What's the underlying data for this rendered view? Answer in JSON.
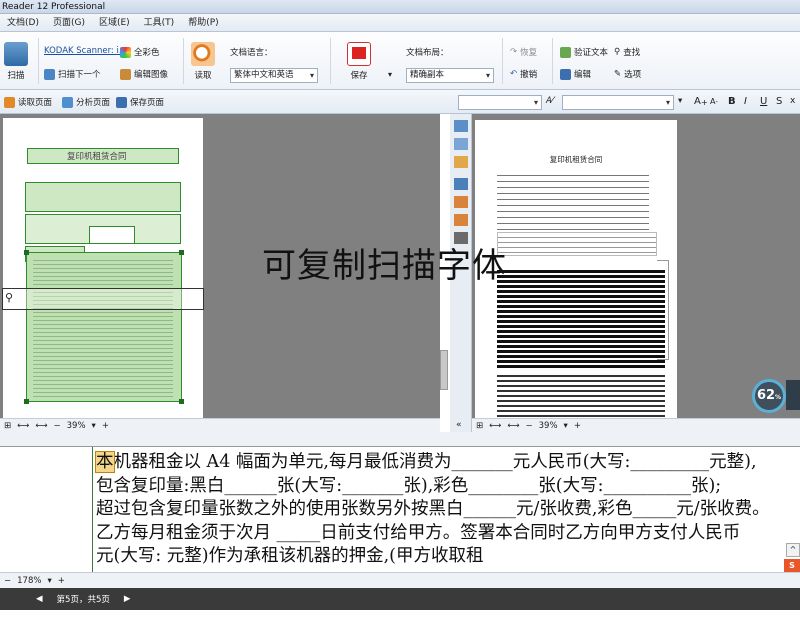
{
  "app": {
    "title": "Reader 12 Professional"
  },
  "menu": [
    "文档(D)",
    "页面(G)",
    "区域(E)",
    "工具(T)",
    "帮助(P)"
  ],
  "ribbon": {
    "scan_label": "扫描",
    "scanner_name": "KODAK Scanner: i...",
    "scan_next_label": "扫描下一个",
    "full_color_label": "全彩色",
    "edit_image_label": "编辑图像",
    "read_label": "读取",
    "doc_language_label": "文档语言：",
    "doc_language_value": "繁体中文和英语",
    "save_label": "保存",
    "doc_layout_label": "文档布局：",
    "doc_layout_value": "精确副本",
    "redo_label": "恢复",
    "undo_label": "撤销",
    "verify_text_label": "验证文本",
    "edit_label": "编辑",
    "find_label": "查找",
    "options_label": "选项"
  },
  "subtool": {
    "read_page_label": "读取页面",
    "analyze_page_label": "分析页面",
    "save_page_label": "保存页面",
    "font_size_a_plus": "A",
    "font_size_a_minus": "A",
    "bold": "B",
    "italic": "I",
    "underline": "U",
    "strike": "S",
    "super": "x²"
  },
  "left_page": {
    "title": "复印机租赁合同",
    "zoom": "39%"
  },
  "right_page": {
    "title": "复印机租赁合同",
    "zoom": "39%"
  },
  "overlay_text": "可复制扫描字体",
  "gauge_value": "62",
  "gauge_unit": "%",
  "text_editor": {
    "cursor_char": "本",
    "lines": [
      "机器租金以 A4 幅面为单元,每月最低消费为_______元人民币(大写:_________元整),",
      "包含复印量:黑白______张(大写:_______张),彩色________张(大写:__________张);",
      "超过包含复印量张数之外的使用张数另外按黑白______元/张收费,彩色_____元/张收费。",
      "乙方每月租金须于次月 _____日前支付给甲方。签署本合同时乙方向甲方支付人民币",
      "         元(大写:                元整)作为承租该机器的押金,(甲方收取租"
    ],
    "zoom": "178%"
  },
  "status": {
    "page_info": "第5页，共5页"
  },
  "colors": {
    "ocr_green": "#2e8b2e",
    "ocr_fill": "#cfe8c4",
    "gauge_ring": "#5ab0d8"
  }
}
